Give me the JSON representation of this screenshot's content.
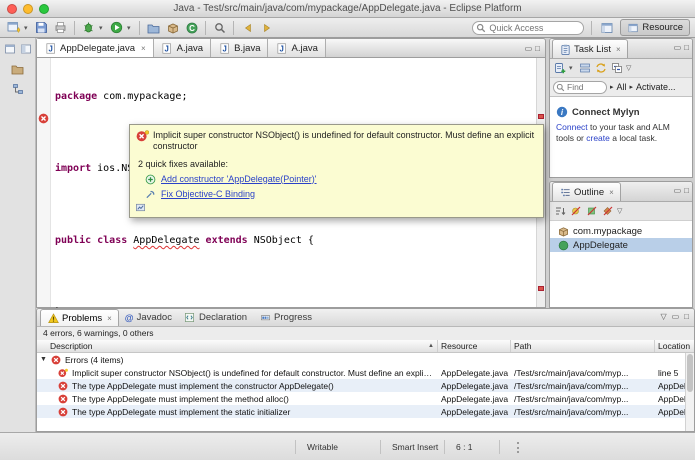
{
  "window": {
    "title": "Java - Test/src/main/java/com/mypackage/AppDelegate.java - Eclipse Platform"
  },
  "toolbar": {
    "quick_access_placeholder": "Quick Access",
    "perspective_label": "Resource"
  },
  "editor": {
    "tabs": [
      {
        "label": "AppDelegate.java"
      },
      {
        "label": "A.java"
      },
      {
        "label": "B.java"
      },
      {
        "label": "A.java"
      }
    ],
    "code": {
      "l1_kw": "package",
      "l1_rest": " com.mypackage;",
      "l3_kw": "import",
      "l3_rest": " ios.NSObject;",
      "l5_kw1": "public class ",
      "l5_name": "AppDelegate",
      "l5_sp": " ",
      "l5_kw2": "extends",
      "l5_rest": " NSObject {",
      "l7": "}"
    }
  },
  "quickfix": {
    "message": "Implicit super constructor NSObject() is undefined for default constructor. Must define an explicit constructor",
    "fixes_label": "2 quick fixes available:",
    "fix1": "Add constructor 'AppDelegate(Pointer)'",
    "fix2": "Fix Objective-C Binding"
  },
  "task_list": {
    "title": "Task List",
    "find_placeholder": "Find",
    "all_label": "All",
    "activate_label": "Activate..."
  },
  "mylyn": {
    "title": "Connect Mylyn",
    "link1": "Connect",
    "text1": " to your task and ALM tools or ",
    "link2": "create",
    "text2": " a local task."
  },
  "outline": {
    "title": "Outline",
    "package_label": "com.mypackage",
    "class_label": "AppDelegate"
  },
  "problems": {
    "tabs": [
      "Problems",
      "Javadoc",
      "Declaration",
      "Progress"
    ],
    "summary": "4 errors, 6 warnings, 0 others",
    "columns": [
      "Description",
      "Resource",
      "Path",
      "Location"
    ],
    "group_label": "Errors (4 items)",
    "rows": [
      {
        "description": "Implicit super constructor NSObject() is undefined for default constructor. Must define an explicit constructor",
        "resource": "AppDelegate.java",
        "path": "/Test/src/main/java/com/myp...",
        "location": "line 5"
      },
      {
        "description": "The type AppDelegate must implement the constructor AppDelegate()",
        "resource": "AppDelegate.java",
        "path": "/Test/src/main/java/com/myp...",
        "location": "AppDelegate"
      },
      {
        "description": "The type AppDelegate must implement the method alloc()",
        "resource": "AppDelegate.java",
        "path": "/Test/src/main/java/com/myp...",
        "location": "AppDelegate"
      },
      {
        "description": "The type AppDelegate must implement the static initializer",
        "resource": "AppDelegate.java",
        "path": "/Test/src/main/java/com/myp...",
        "location": "AppDelegate"
      }
    ]
  },
  "status_bar": {
    "writable": "Writable",
    "insert_mode": "Smart Insert",
    "cursor_position": "6 : 1"
  },
  "colors": {
    "keyword": "#7f0055",
    "error_red": "#d84039",
    "link_blue": "#2a41c8",
    "tooltip_bg": "#fbfcd2",
    "selection_blue": "#b9cfe8"
  },
  "icons": {
    "close": "×",
    "chevron_down": "▾",
    "triangle_right": "▸",
    "expander_down": "▼",
    "view_menu": "▽",
    "minimize_glyph": "▭",
    "maximize_glyph": "□",
    "javadoc_at": "@",
    "java_letter": "J",
    "class_letter": "C",
    "sort_asc": "▲",
    "info_letter": "i"
  }
}
